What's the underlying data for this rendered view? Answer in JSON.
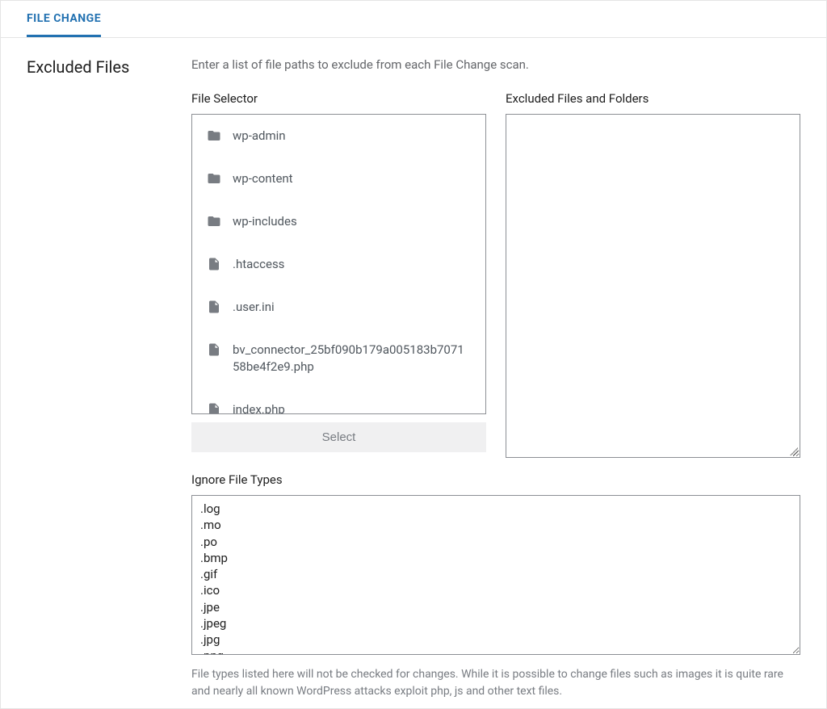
{
  "tab": {
    "label": "FILE CHANGE"
  },
  "section": {
    "title": "Excluded Files",
    "description": "Enter a list of file paths to exclude from each File Change scan."
  },
  "file_selector": {
    "label": "File Selector",
    "items": [
      {
        "type": "folder",
        "name": "wp-admin"
      },
      {
        "type": "folder",
        "name": "wp-content"
      },
      {
        "type": "folder",
        "name": "wp-includes"
      },
      {
        "type": "file",
        "name": ".htaccess"
      },
      {
        "type": "file",
        "name": ".user.ini"
      },
      {
        "type": "file",
        "name": "bv_connector_25bf090b179a005183b707158be4f2e9.php"
      },
      {
        "type": "file",
        "name": "index.php"
      }
    ],
    "select_button": "Select"
  },
  "excluded": {
    "label": "Excluded Files and Folders",
    "value": ""
  },
  "ignore": {
    "label": "Ignore File Types",
    "value": ".log\n.mo\n.po\n.bmp\n.gif\n.ico\n.jpe\n.jpeg\n.jpg\n.png",
    "help": "File types listed here will not be checked for changes. While it is possible to change files such as images it is quite rare and nearly all known WordPress attacks exploit php, js and other text files."
  }
}
